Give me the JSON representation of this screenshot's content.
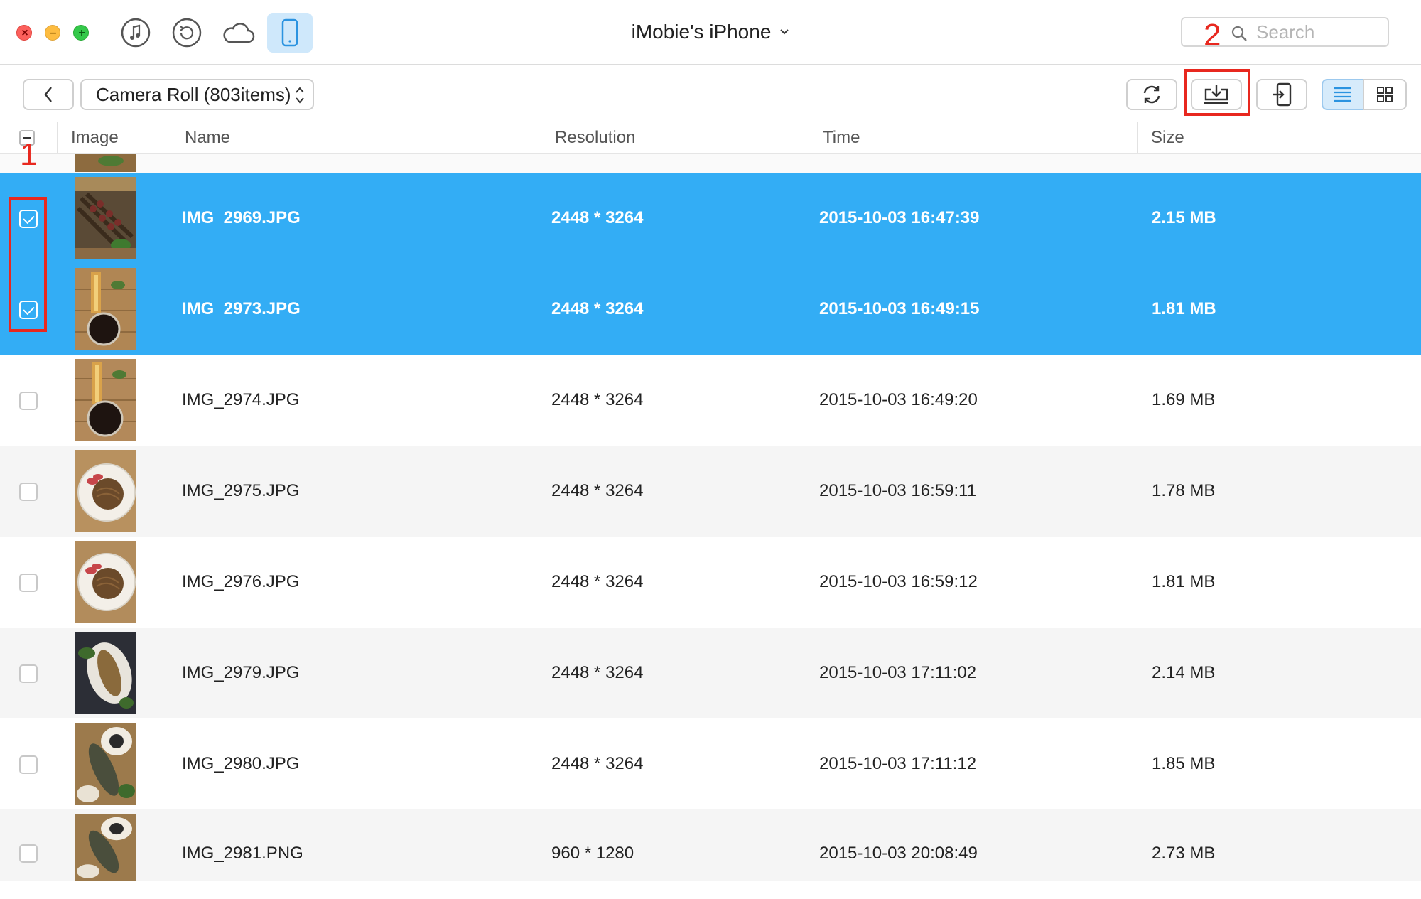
{
  "window": {
    "title": "iMobie's iPhone"
  },
  "nav": {
    "icons": [
      "music-note-icon",
      "history-icon",
      "cloud-icon",
      "phone-icon"
    ],
    "active": "phone-icon"
  },
  "search": {
    "placeholder": "Search",
    "value": ""
  },
  "toolbar": {
    "album_label": "Camera Roll (803items)",
    "view_mode": "list"
  },
  "table": {
    "headers": {
      "image": "Image",
      "name": "Name",
      "resolution": "Resolution",
      "time": "Time",
      "size": "Size"
    },
    "rows": [
      {
        "name": "IMG_2969.JPG",
        "resolution": "2448 * 3264",
        "time": "2015-10-03 16:47:39",
        "size": "2.15 MB",
        "selected": true,
        "thumb": "skewers-on-grill"
      },
      {
        "name": "IMG_2973.JPG",
        "resolution": "2448 * 3264",
        "time": "2015-10-03 16:49:15",
        "size": "1.81 MB",
        "selected": true,
        "thumb": "skewers-and-drink"
      },
      {
        "name": "IMG_2974.JPG",
        "resolution": "2448 * 3264",
        "time": "2015-10-03 16:49:20",
        "size": "1.69 MB",
        "selected": false,
        "thumb": "skewers-and-drink"
      },
      {
        "name": "IMG_2975.JPG",
        "resolution": "2448 * 3264",
        "time": "2015-10-03 16:59:11",
        "size": "1.78 MB",
        "selected": false,
        "thumb": "noodle-plate"
      },
      {
        "name": "IMG_2976.JPG",
        "resolution": "2448 * 3264",
        "time": "2015-10-03 16:59:12",
        "size": "1.81 MB",
        "selected": false,
        "thumb": "noodle-plate"
      },
      {
        "name": "IMG_2979.JPG",
        "resolution": "2448 * 3264",
        "time": "2015-10-03 17:11:02",
        "size": "2.14 MB",
        "selected": false,
        "thumb": "grilled-fish-dark"
      },
      {
        "name": "IMG_2980.JPG",
        "resolution": "2448 * 3264",
        "time": "2015-10-03 17:11:12",
        "size": "1.85 MB",
        "selected": false,
        "thumb": "grilled-fish-plates"
      },
      {
        "name": "IMG_2981.PNG",
        "resolution": "960 * 1280",
        "time": "2015-10-03 20:08:49",
        "size": "2.73 MB",
        "selected": false,
        "thumb": "grilled-fish-plates"
      }
    ]
  },
  "annotations": {
    "step1": "1",
    "step2": "2",
    "color": "#e8281f"
  },
  "colors": {
    "selection": "#33adf5",
    "active_tab_bg": "#cfe8fb",
    "alt_row": "#f5f5f5"
  }
}
